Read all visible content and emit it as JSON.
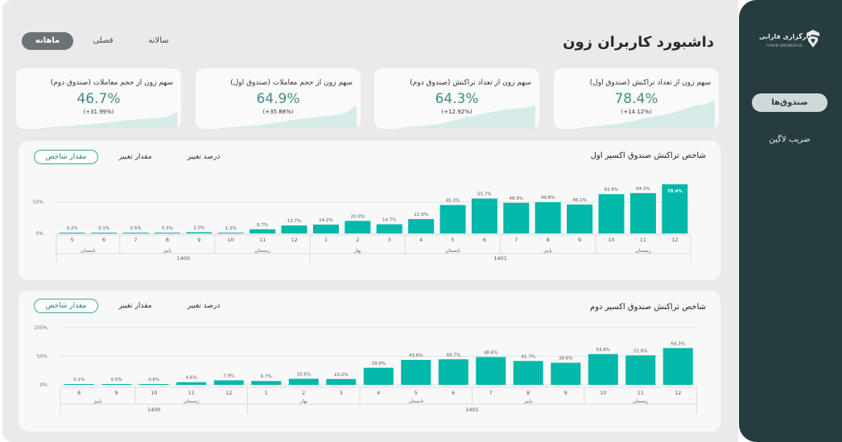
{
  "title": "داشبورد کاربران زون",
  "logo": {
    "text": "کارگزاری فارابی",
    "sub": "FARABI BROKERAGE"
  },
  "sidebar": {
    "items": [
      {
        "label": "صندوق‌ها",
        "active": true
      },
      {
        "label": "ضریب لاگین",
        "active": false
      }
    ]
  },
  "period": {
    "buttons": [
      {
        "label": "ماهانه",
        "active": true
      },
      {
        "label": "فصلی",
        "active": false
      },
      {
        "label": "سالانه",
        "active": false
      }
    ]
  },
  "kpis": [
    {
      "title": "سهم زون از تعداد تراکنش (صندوق اول)",
      "value": "78.4%",
      "change": "(+14.12%)",
      "trend": [
        0.02,
        0.05,
        0.08,
        0.1,
        0.13,
        0.18,
        0.23,
        0.3,
        0.35,
        0.4,
        0.46,
        0.55,
        0.63,
        0.66,
        0.78
      ]
    },
    {
      "title": "سهم زون از تعداد تراکنش (صندوق دوم)",
      "value": "64.3%",
      "change": "(+12.92%)",
      "trend": [
        0.02,
        0.05,
        0.07,
        0.09,
        0.12,
        0.18,
        0.25,
        0.32,
        0.38,
        0.43,
        0.48,
        0.52,
        0.55,
        0.58,
        0.64
      ]
    },
    {
      "title": "سهم زون از حجم معاملات (صندوق اول)",
      "value": "64.9%",
      "change": "(+35.88%)",
      "trend": [
        0.02,
        0.04,
        0.06,
        0.08,
        0.1,
        0.14,
        0.18,
        0.22,
        0.26,
        0.3,
        0.32,
        0.35,
        0.38,
        0.45,
        0.65
      ]
    },
    {
      "title": "سهم زون از حجم معاملات (صندوق دوم)",
      "value": "46.7%",
      "change": "(+31.99%)",
      "trend": [
        0.02,
        0.04,
        0.06,
        0.08,
        0.1,
        0.12,
        0.15,
        0.18,
        0.21,
        0.24,
        0.26,
        0.28,
        0.3,
        0.33,
        0.47
      ]
    }
  ],
  "colors": {
    "bar": "#01b8aa",
    "accent": "#3f8c83",
    "sidebar": "#263c3f",
    "spark": "#d7ece8"
  },
  "tabs": [
    "مقدار شاخص",
    "مقدار تغییر",
    "درصد تغییر"
  ],
  "chart_data": [
    {
      "type": "bar",
      "title": "شاخص تراکنش صندوق اکسیر اول",
      "categories": [
        "5",
        "6",
        "7",
        "8",
        "9",
        "10",
        "11",
        "12",
        "1",
        "2",
        "3",
        "4",
        "5",
        "6",
        "7",
        "8",
        "9",
        "10",
        "11",
        "12"
      ],
      "values": [
        0.2,
        0.1,
        0.5,
        0.3,
        2.0,
        1.2,
        6.7,
        12.7,
        14.2,
        20.0,
        14.7,
        22.9,
        45.3,
        55.7,
        48.9,
        49.8,
        46.1,
        62.6,
        64.3,
        78.4
      ],
      "labels": [
        "0.2%",
        "0.1%",
        "0.5%",
        "0.3%",
        "2.0%",
        "1.2%",
        "6.7%",
        "12.7%",
        "14.2%",
        "20.0%",
        "14.7%",
        "22.9%",
        "45.3%",
        "55.7%",
        "48.9%",
        "49.8%",
        "46.1%",
        "62.6%",
        "64.3%",
        "78.4%"
      ],
      "yticks": [
        "0%",
        "50%"
      ],
      "ylim": [
        0,
        100
      ],
      "seasons": [
        {
          "label": "تابستان",
          "count": 2
        },
        {
          "label": "پاییز",
          "count": 3
        },
        {
          "label": "زمستان",
          "count": 3
        },
        {
          "label": "بهار",
          "count": 3
        },
        {
          "label": "تابستان",
          "count": 3
        },
        {
          "label": "پاییز",
          "count": 3
        },
        {
          "label": "زمستان",
          "count": 3
        }
      ],
      "years": [
        {
          "label": "1400",
          "count": 8
        },
        {
          "label": "1401",
          "count": 12
        }
      ]
    },
    {
      "type": "bar",
      "title": "شاخص تراکنش صندوق اکسیر دوم",
      "categories": [
        "8",
        "9",
        "10",
        "11",
        "12",
        "1",
        "2",
        "3",
        "4",
        "5",
        "6",
        "7",
        "8",
        "9",
        "10",
        "11",
        "12"
      ],
      "values": [
        0.1,
        0.5,
        0.6,
        4.6,
        7.9,
        6.7,
        10.6,
        10.2,
        29.9,
        43.6,
        44.7,
        48.6,
        41.7,
        38.6,
        53.8,
        51.6,
        64.3
      ],
      "labels": [
        "0.1%",
        "0.5%",
        "0.6%",
        "4.6%",
        "7.9%",
        "6.7%",
        "10.6%",
        "10.2%",
        "29.9%",
        "43.6%",
        "44.7%",
        "48.6%",
        "41.7%",
        "38.6%",
        "53.8%",
        "51.6%",
        "64.3%"
      ],
      "yticks": [
        "0%",
        "50%",
        "100%"
      ],
      "ylim": [
        0,
        100
      ],
      "seasons": [
        {
          "label": "پاییز",
          "count": 2
        },
        {
          "label": "زمستان",
          "count": 3
        },
        {
          "label": "بهار",
          "count": 3
        },
        {
          "label": "تابستان",
          "count": 3
        },
        {
          "label": "پاییز",
          "count": 3
        },
        {
          "label": "زمستان",
          "count": 3
        }
      ],
      "years": [
        {
          "label": "1400",
          "count": 5
        },
        {
          "label": "1401",
          "count": 12
        }
      ]
    }
  ]
}
